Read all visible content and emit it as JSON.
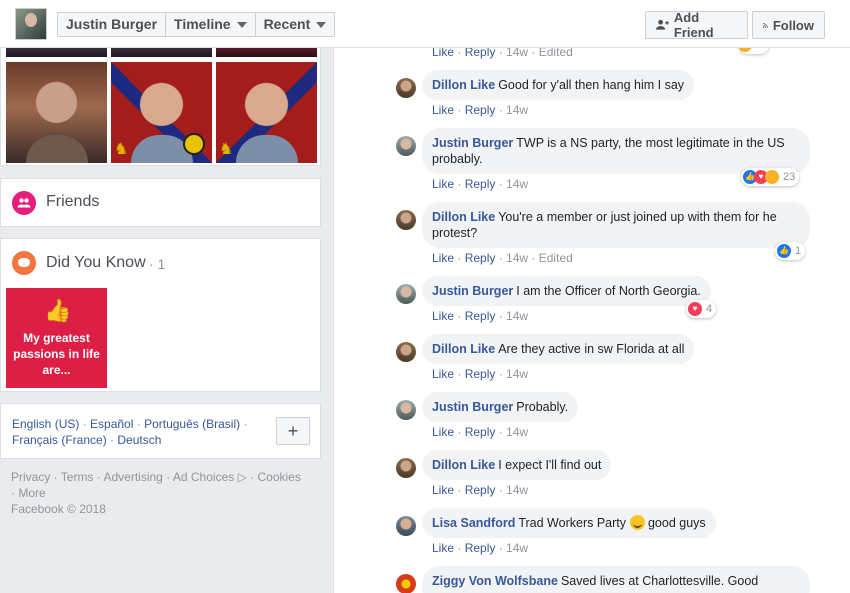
{
  "header": {
    "profile_name": "Justin Burger",
    "timeline_label": "Timeline",
    "recent_label": "Recent",
    "add_friend_label": "Add Friend",
    "follow_label": "Follow"
  },
  "left": {
    "friends_label": "Friends",
    "did_you_know_label": "Did You Know",
    "did_you_know_count": "· 1",
    "dyk_tile_text": "My greatest passions in life are...",
    "languages": {
      "english": "English (US)",
      "espanol": "Español",
      "portugues": "Português (Brasil)",
      "francais": "Français (France)",
      "deutsch": "Deutsch"
    },
    "footer": {
      "privacy": "Privacy",
      "terms": "Terms",
      "advertising": "Advertising",
      "ad_choices": "Ad Choices",
      "cookies": "Cookies",
      "more": "More",
      "copyright": "Facebook © 2018"
    }
  },
  "comments": [
    {
      "name": "",
      "text": "",
      "like": "Like",
      "reply": "Reply",
      "time": "14w",
      "edited": "Edited"
    },
    {
      "name": "Dillon Like",
      "text": "Good for y'all then hang him I say",
      "like": "Like",
      "reply": "Reply",
      "time": "14w"
    },
    {
      "name": "Justin Burger",
      "text": "TWP is a NS party, the most legitimate in the US probably.",
      "like": "Like",
      "reply": "Reply",
      "time": "14w",
      "reactions": "23"
    },
    {
      "name": "Dillon Like",
      "text": "You're a member or just joined up with them for he protest?",
      "like": "Like",
      "reply": "Reply",
      "time": "14w",
      "edited": "Edited",
      "reactions": "1"
    },
    {
      "name": "Justin Burger",
      "text": "I am the Officer of North Georgia.",
      "like": "Like",
      "reply": "Reply",
      "time": "14w",
      "reactions": "4"
    },
    {
      "name": "Dillon Like",
      "text": "Are they active in sw Florida at all",
      "like": "Like",
      "reply": "Reply",
      "time": "14w"
    },
    {
      "name": "Justin Burger",
      "text": "Probably.",
      "like": "Like",
      "reply": "Reply",
      "time": "14w"
    },
    {
      "name": "Dillon Like",
      "text": "I expect I'll find out",
      "like": "Like",
      "reply": "Reply",
      "time": "14w"
    },
    {
      "name": "Lisa Sandford",
      "text": "Trad Workers Party",
      "text_after": "good guys",
      "like": "Like",
      "reply": "Reply",
      "time": "14w"
    },
    {
      "name": "Ziggy Von Wolfsbane",
      "text": "Saved lives at Charlottesville. Good"
    }
  ],
  "colors": {
    "link": "#385898",
    "like_reaction": "#1877f2",
    "love_reaction": "#f33e58",
    "dyk_tile": "#dd1f46"
  }
}
